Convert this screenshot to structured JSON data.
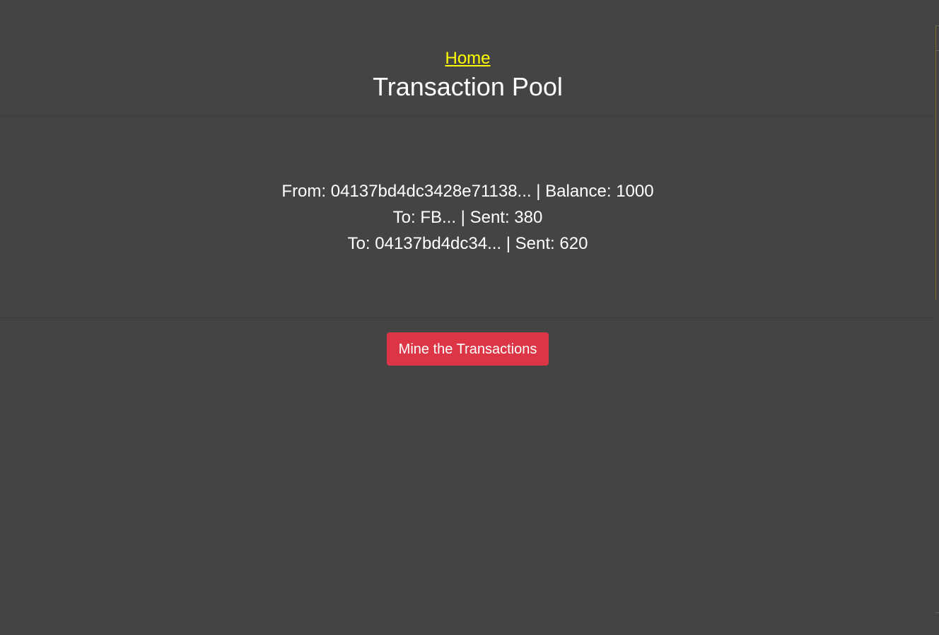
{
  "nav": {
    "home_label": "Home"
  },
  "header": {
    "title": "Transaction Pool"
  },
  "transactions": [
    {
      "from_line": "From: 04137bd4dc3428e71138... | Balance: 1000",
      "outputs": [
        "To: FB... | Sent: 380",
        "To: 04137bd4dc34... | Sent: 620"
      ]
    }
  ],
  "actions": {
    "mine_label": "Mine the Transactions"
  },
  "colors": {
    "background": "#444444",
    "link": "#ffff00",
    "text": "#ffffff",
    "danger_button": "#dc3545"
  }
}
